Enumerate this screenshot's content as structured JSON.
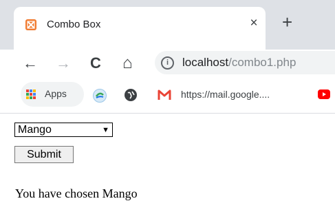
{
  "browser": {
    "tab": {
      "title": "Combo Box",
      "close_glyph": "×"
    },
    "new_tab_glyph": "+",
    "nav": {
      "back": "←",
      "forward": "→",
      "reload": "C",
      "home": "⌂"
    },
    "omnibox": {
      "url_host": "localhost",
      "url_path": "/combo1.php",
      "info_glyph": "i"
    },
    "bookmarks": {
      "apps_label": "Apps",
      "gmail_label": "https://mail.google...."
    },
    "colors": {
      "chrome_frame": "#dee1e6",
      "omnibox_bg": "#f1f3f4",
      "favicon": "#f07a2f"
    }
  },
  "page": {
    "select": {
      "value": "Mango",
      "arrow": "▼"
    },
    "submit_label": "Submit",
    "result_text": "You have chosen Mango"
  }
}
